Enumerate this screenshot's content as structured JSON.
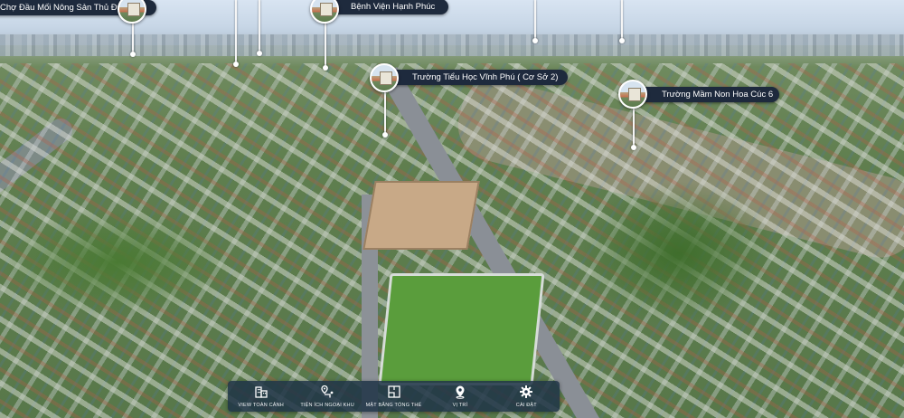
{
  "pins": [
    {
      "id": "market",
      "label": "Chợ Đầu Mối Nông Sản Thủ Đức"
    },
    {
      "id": "hospital",
      "label": "Bệnh Viện Hạnh Phúc"
    },
    {
      "id": "primary-school",
      "label": "Trường Tiểu Học Vĩnh Phú ( Cơ Sở 2)"
    },
    {
      "id": "kindergarten",
      "label": "Trường Mầm Non Hoa Cúc 6"
    }
  ],
  "toolbar": {
    "items": [
      {
        "label": "VIEW TOÀN CẢNH",
        "icon": "buildings-icon"
      },
      {
        "label": "TIỆN ÍCH NGOẠI KHU",
        "icon": "map-pin-route-icon"
      },
      {
        "label": "MẶT BẰNG TỔNG THỂ",
        "icon": "floor-plan-icon"
      },
      {
        "label": "VỊ TRÍ",
        "icon": "location-icon"
      },
      {
        "label": "CÀI ĐẶT",
        "icon": "gear-icon"
      }
    ]
  },
  "colors": {
    "label_bg": "#1e2a3d",
    "toolbar_bg": "#203447",
    "text": "#ffffff"
  }
}
